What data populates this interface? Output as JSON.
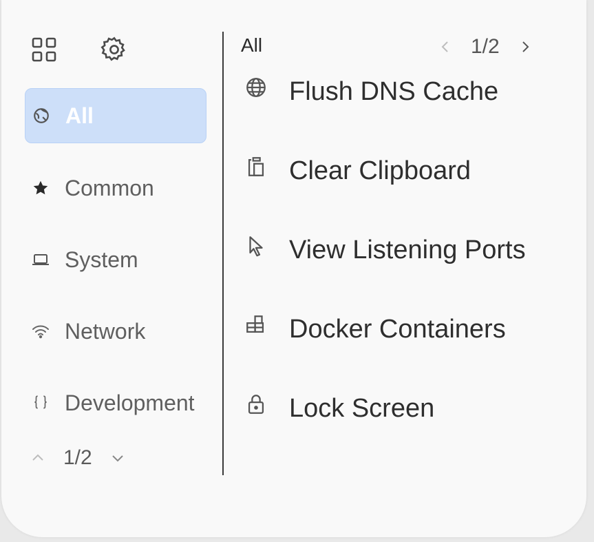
{
  "toolbar": {
    "grid_icon": "grid-icon",
    "settings_icon": "gear-icon"
  },
  "categories": [
    {
      "label": "All",
      "icon": "globe-pin-icon",
      "active": true
    },
    {
      "label": "Common",
      "icon": "star-icon",
      "active": false
    },
    {
      "label": "System",
      "icon": "laptop-icon",
      "active": false
    },
    {
      "label": "Network",
      "icon": "wifi-icon",
      "active": false
    },
    {
      "label": "Development",
      "icon": "braces-icon",
      "active": false
    }
  ],
  "category_pager": {
    "text": "1/2"
  },
  "main": {
    "section_title": "All",
    "pager_text": "1/2",
    "commands": [
      {
        "label": "Flush DNS Cache",
        "icon": "globe-icon"
      },
      {
        "label": "Clear Clipboard",
        "icon": "clipboard-icon"
      },
      {
        "label": "View Listening Ports",
        "icon": "cursor-icon"
      },
      {
        "label": "Docker Containers",
        "icon": "containers-icon"
      },
      {
        "label": "Lock Screen",
        "icon": "lock-icon"
      }
    ]
  },
  "colors": {
    "active_bg": "#cddff9",
    "panel_bg": "#f9f9f9"
  }
}
